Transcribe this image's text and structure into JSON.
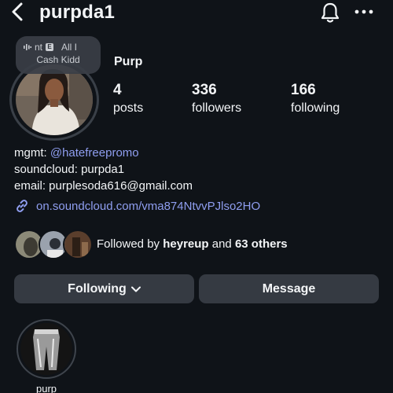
{
  "header": {
    "username": "purpda1",
    "icons": {
      "back": "back-arrow-icon",
      "notifications": "bell-icon",
      "more": "more-options-icon"
    }
  },
  "profile": {
    "display_name": "Purp",
    "note": {
      "left": "nt",
      "explicit": "E",
      "right": "All I",
      "artist": "Cash Kidd"
    },
    "stats": [
      {
        "value": "4",
        "label": "posts"
      },
      {
        "value": "336",
        "label": "followers"
      },
      {
        "value": "166",
        "label": "following"
      }
    ]
  },
  "bio": {
    "mgmt_prefix": "mgmt:",
    "mgmt_handle": "@hatefreepromo",
    "soundcloud": "soundcloud: purpda1",
    "email": "email: purplesoda616@gmail.com",
    "link": "on.soundcloud.com/vma874NtvvPJlso2HO"
  },
  "followed_by": {
    "prefix": "Followed by",
    "user": "heyreup",
    "joiner": "and",
    "others": "63 others"
  },
  "actions": {
    "following": "Following",
    "message": "Message"
  },
  "highlights": [
    {
      "label": "purp"
    }
  ],
  "colors": {
    "background": "#0f1318",
    "button": "#353a42",
    "link": "#8f9ef0",
    "text": "#f3f5f7"
  }
}
